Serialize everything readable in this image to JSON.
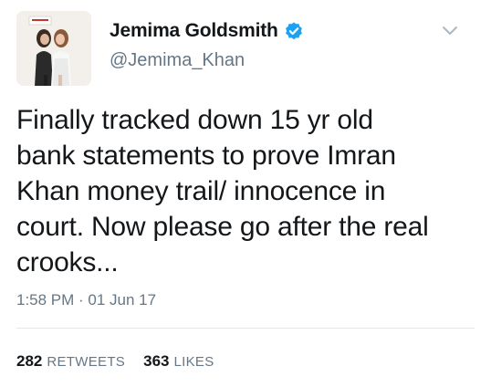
{
  "colors": {
    "text_primary": "#14171a",
    "text_secondary": "#657786",
    "verified_blue": "#1da1f2",
    "divider": "#e1e8ed"
  },
  "author": {
    "display_name": "Jemima Goldsmith",
    "handle": "@Jemima_Khan",
    "verified_icon": "verified-badge-icon",
    "avatar_icon": "profile-photo"
  },
  "menu": {
    "icon": "chevron-down-icon"
  },
  "tweet": {
    "text": "Finally tracked down 15 yr old\nbank statements to prove Imran\nKhan money trail/ innocence in\ncourt. Now please go after the real\ncrooks...",
    "timestamp": "1:58 PM · 01 Jun 17"
  },
  "stats": {
    "retweets_count": "282",
    "retweets_label": "RETWEETS",
    "likes_count": "363",
    "likes_label": "LIKES"
  }
}
